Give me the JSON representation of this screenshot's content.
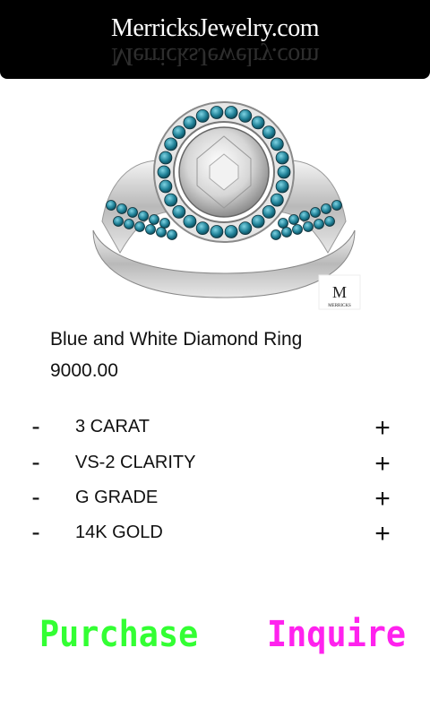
{
  "header": {
    "brand": "MerricksJewelry.com"
  },
  "product": {
    "image_alt": "blue and white diamond halo ring",
    "watermark_letter": "M",
    "watermark_text": "MERRICKS",
    "name": "Blue and White Diamond Ring",
    "price": "9000.00"
  },
  "options": [
    {
      "label": "3 CARAT",
      "minus": "-",
      "plus": "+"
    },
    {
      "label": "VS-2 CLARITY",
      "minus": "-",
      "plus": "+"
    },
    {
      "label": "G GRADE",
      "minus": "-",
      "plus": "+"
    },
    {
      "label": "14K GOLD",
      "minus": "-",
      "plus": "+"
    }
  ],
  "actions": {
    "purchase_label": "Purchase",
    "inquire_label": "Inquire"
  },
  "colors": {
    "header_bg": "#000000",
    "purchase": "#33ff33",
    "inquire": "#ff22ee",
    "text": "#111111",
    "blue_diamond": "#1e7f95"
  }
}
